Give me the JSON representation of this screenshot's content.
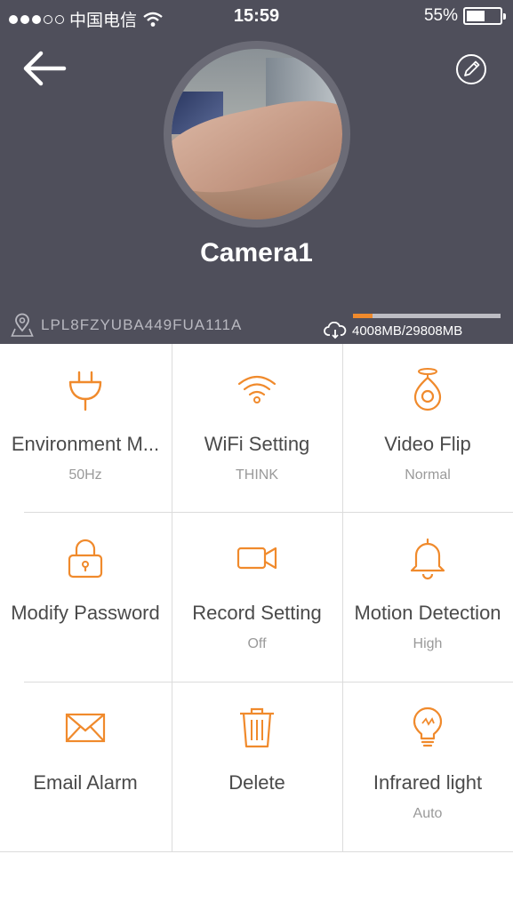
{
  "status_bar": {
    "carrier": "中国电信",
    "time": "15:59",
    "battery": "55%",
    "battery_level": 0.55
  },
  "header": {
    "camera_name": "Camera1",
    "device_id": "LPL8FZYUBA449FUA111A",
    "storage_text": "4008MB/29808MB",
    "storage_used_fraction": 0.134,
    "accent": "#f08a2c",
    "background": "#4f4f5b"
  },
  "settings": [
    {
      "label": "Environment M...",
      "value": "50Hz",
      "icon": "plug-icon"
    },
    {
      "label": "WiFi Setting",
      "value": "THINK",
      "icon": "wifi-icon"
    },
    {
      "label": "Video Flip",
      "value": "Normal",
      "icon": "camera-lens-icon"
    },
    {
      "label": "Modify Password",
      "value": "",
      "icon": "lock-icon"
    },
    {
      "label": "Record Setting",
      "value": "Off",
      "icon": "video-camera-icon"
    },
    {
      "label": "Motion Detection",
      "value": "High",
      "icon": "bell-icon"
    },
    {
      "label": "Email Alarm",
      "value": "",
      "icon": "envelope-icon"
    },
    {
      "label": "Delete",
      "value": "",
      "icon": "trash-icon"
    },
    {
      "label": "Infrared light",
      "value": "Auto",
      "icon": "lightbulb-icon"
    }
  ]
}
